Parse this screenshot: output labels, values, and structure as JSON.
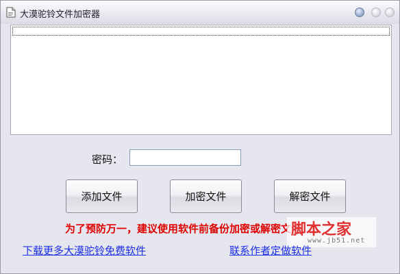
{
  "window": {
    "title": "大漠驼铃文件加密器"
  },
  "file_list": {
    "items": []
  },
  "password": {
    "label": "密码：",
    "value": "",
    "placeholder": ""
  },
  "buttons": {
    "add_file": "添加文件",
    "encrypt_file": "加密文件",
    "decrypt_file": "解密文件"
  },
  "warning_text": "为了预防万一，建议使用软件前备份加密或解密文件",
  "watermark": {
    "main": "脚本之家",
    "sub": "www.jb51.net"
  },
  "links": {
    "more_software": "下载更多大漠驼铃免费软件",
    "contact_author": "联系作者定做软件"
  },
  "colors": {
    "warning": "#e00000",
    "link": "#1a2ee8",
    "window_bg": "#e6e6ee"
  }
}
